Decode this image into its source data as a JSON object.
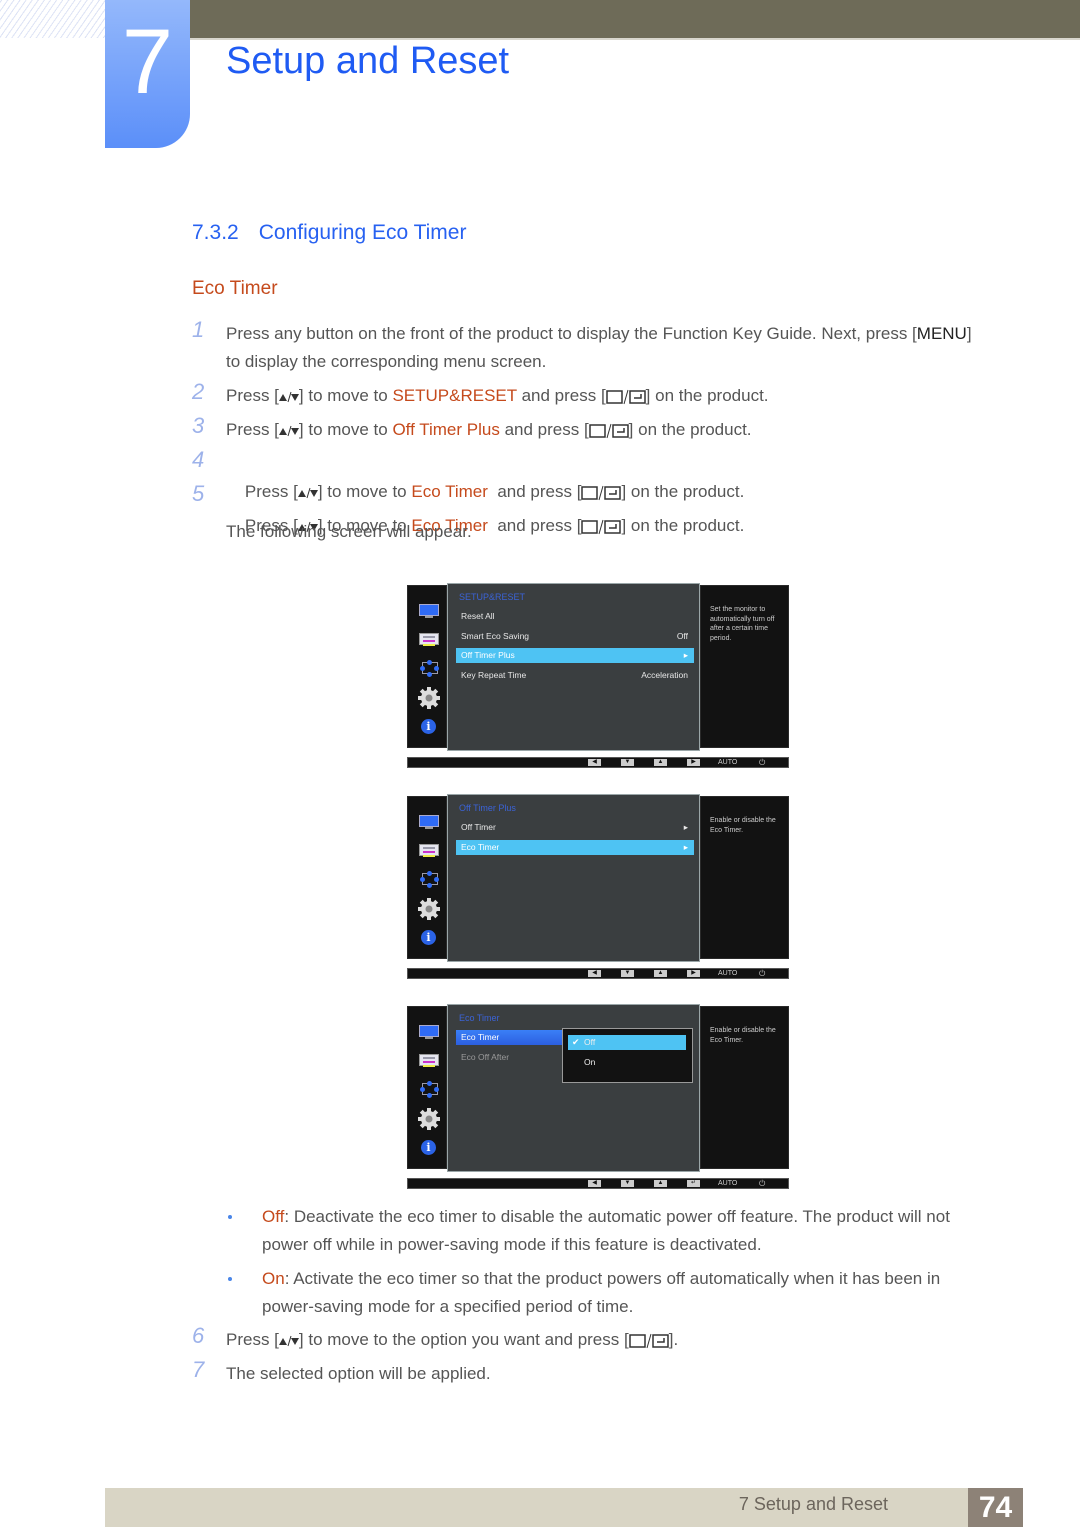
{
  "header": {
    "chapter_number": "7",
    "chapter_title": "Setup and Reset"
  },
  "section": {
    "number": "7.3.2",
    "title": "Configuring Eco Timer",
    "subtitle": "Eco Timer"
  },
  "steps": [
    {
      "n": "1",
      "pre": "Press any button on the front of the product to display the Function Key Guide. Next, press [",
      "key": "MENU",
      "post": "]",
      "line2": "to display the corresponding menu screen."
    },
    {
      "n": "2",
      "pre": "Press [",
      "mid": "] to move to ",
      "target": "SETUP&RESET",
      "post1": " and press [",
      "post2": "] on the product."
    },
    {
      "n": "3",
      "pre": "Press [",
      "mid": "] to move to ",
      "target": "Off Timer Plus",
      "post1": " and press [",
      "post2": "] on the product."
    },
    {
      "n": "4",
      "pre": "Press [",
      "mid": "] to move to ",
      "target": "Eco Timer",
      "post1": "  and press [",
      "post2": "] on the product."
    },
    {
      "n": "5",
      "pre": "Press [",
      "mid": "] to move to ",
      "target": "Eco Timer",
      "post1": "  and press [",
      "post2": "] on the product.",
      "line2": "The following screen will appear."
    },
    {
      "n": "6",
      "pre": "Press [",
      "mid": "] to move to the option you want and press [",
      "post2": "]."
    },
    {
      "n": "7",
      "text": "The selected option will be applied."
    }
  ],
  "osd_screens": [
    {
      "title": "SETUP&RESET",
      "rows": [
        {
          "label": "Reset All",
          "value": ""
        },
        {
          "label": "Smart Eco Saving",
          "value": "Off"
        },
        {
          "label": "Off Timer Plus",
          "value": "▸",
          "selected": true
        },
        {
          "label": "Key Repeat Time",
          "value": "Acceleration"
        }
      ],
      "help": "Set the monitor to automatically turn off after a certain time period.",
      "bar_buttons": [
        "◀",
        "▼",
        "▲",
        "▶"
      ],
      "auto_label": "AUTO",
      "power_glyph": "⏻"
    },
    {
      "title": "Off Timer Plus",
      "rows": [
        {
          "label": "Off Timer",
          "value": "▸"
        },
        {
          "label": "Eco Timer",
          "value": "▸",
          "selected": true
        }
      ],
      "help": "Enable or disable the Eco Timer.",
      "bar_buttons": [
        "◀",
        "▼",
        "▲",
        "▶"
      ],
      "auto_label": "AUTO",
      "power_glyph": "⏻"
    },
    {
      "title": "Eco Timer",
      "rows": [
        {
          "label": "Eco Timer",
          "selected": true
        },
        {
          "label": "Eco Off After",
          "dim": true
        }
      ],
      "popup": {
        "options": [
          {
            "label": "Off",
            "checked": true
          },
          {
            "label": "On"
          }
        ],
        "check_glyph": "✔"
      },
      "help": "Enable or disable the Eco Timer.",
      "bar_buttons": [
        "◀",
        "▼",
        "▲",
        "↵"
      ],
      "auto_label": "AUTO",
      "power_glyph": "⏻"
    }
  ],
  "bullets": [
    {
      "term": "Off",
      "text": ": Deactivate the eco timer to disable the automatic power off feature. The product will not power off while in power-saving mode if this feature is deactivated."
    },
    {
      "term": "On",
      "text": ": Activate the eco timer so that the product powers off automatically when it has been in power-saving mode for a specified period of time."
    }
  ],
  "footer": {
    "label": "7 Setup and Reset",
    "page": "74"
  },
  "colors": {
    "heading_blue": "#2761f1",
    "highlight_orange": "#c54a1c",
    "osd_select": "#4ec3f3"
  }
}
